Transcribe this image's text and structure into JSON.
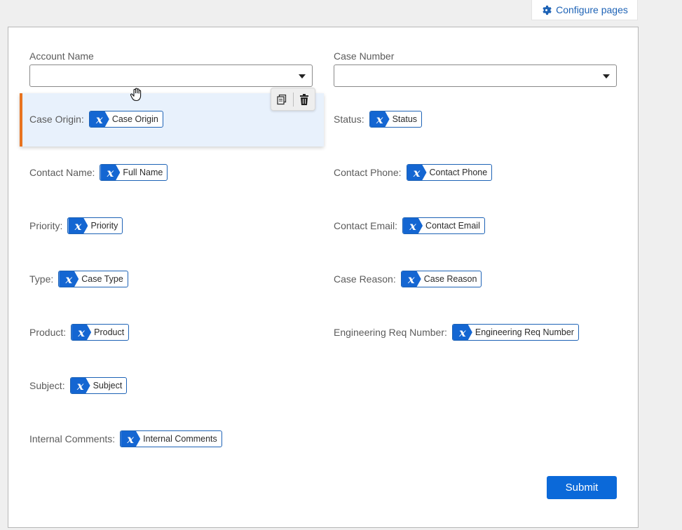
{
  "toolbar": {
    "configure_label": "Configure pages",
    "configure_icon": "gear-icon"
  },
  "top_fields": {
    "account_name": {
      "label": "Account Name",
      "value": ""
    },
    "case_number": {
      "label": "Case Number",
      "value": ""
    }
  },
  "left_rows": [
    {
      "label": "Case Origin:",
      "token": "Case Origin"
    },
    {
      "label": "Contact Name:",
      "token": "Full Name"
    },
    {
      "label": "Priority:",
      "token": "Priority"
    },
    {
      "label": "Type:",
      "token": "Case Type"
    },
    {
      "label": "Product:",
      "token": "Product"
    },
    {
      "label": "Subject:",
      "token": "Subject"
    },
    {
      "label": "Internal Comments:",
      "token": "Internal Comments"
    }
  ],
  "right_rows": [
    {
      "label": "Status:",
      "token": "Status"
    },
    {
      "label": "Contact Phone:",
      "token": "Contact Phone"
    },
    {
      "label": "Contact Email:",
      "token": "Contact Email"
    },
    {
      "label": "Case Reason:",
      "token": "Case Reason"
    },
    {
      "label": "Engineering Req Number:",
      "token": "Engineering Req Number"
    }
  ],
  "token_glyph": "𝒙",
  "submit_label": "Submit",
  "colors": {
    "accent": "#0b69d9",
    "selection_border": "#e8731f",
    "selection_bg": "#e8f1fc"
  }
}
